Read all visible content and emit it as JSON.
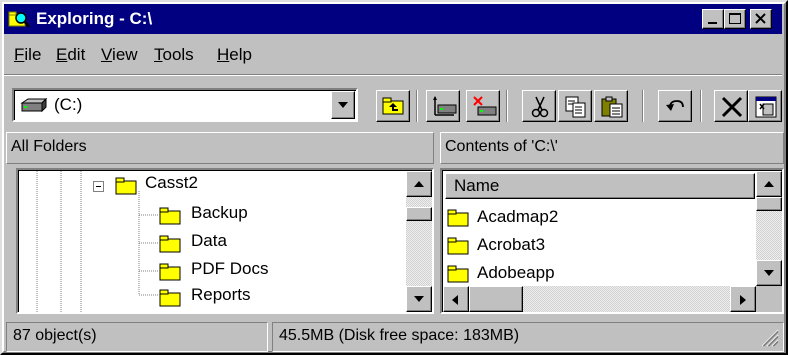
{
  "window": {
    "title": "Exploring - C:\\"
  },
  "menu": {
    "items": [
      {
        "label": "File"
      },
      {
        "label": "Edit"
      },
      {
        "label": "View"
      },
      {
        "label": "Tools"
      },
      {
        "label": "Help"
      }
    ]
  },
  "address": {
    "value": "(C:)"
  },
  "left_pane": {
    "header": "All Folders",
    "tree": [
      {
        "label": "Casst2"
      },
      {
        "label": "Backup"
      },
      {
        "label": "Data"
      },
      {
        "label": "PDF Docs"
      },
      {
        "label": "Reports"
      }
    ]
  },
  "right_pane": {
    "header": "Contents of 'C:\\'",
    "column_name": "Name",
    "items": [
      {
        "label": "Acadmap2"
      },
      {
        "label": "Acrobat3"
      },
      {
        "label": "Adobeapp"
      }
    ]
  },
  "status": {
    "objects": "87 object(s)",
    "space": "45.5MB (Disk free space: 183MB)"
  },
  "colors": {
    "titlebar": "#000080",
    "face": "#c0c0c0",
    "folder": "#ffff00"
  }
}
